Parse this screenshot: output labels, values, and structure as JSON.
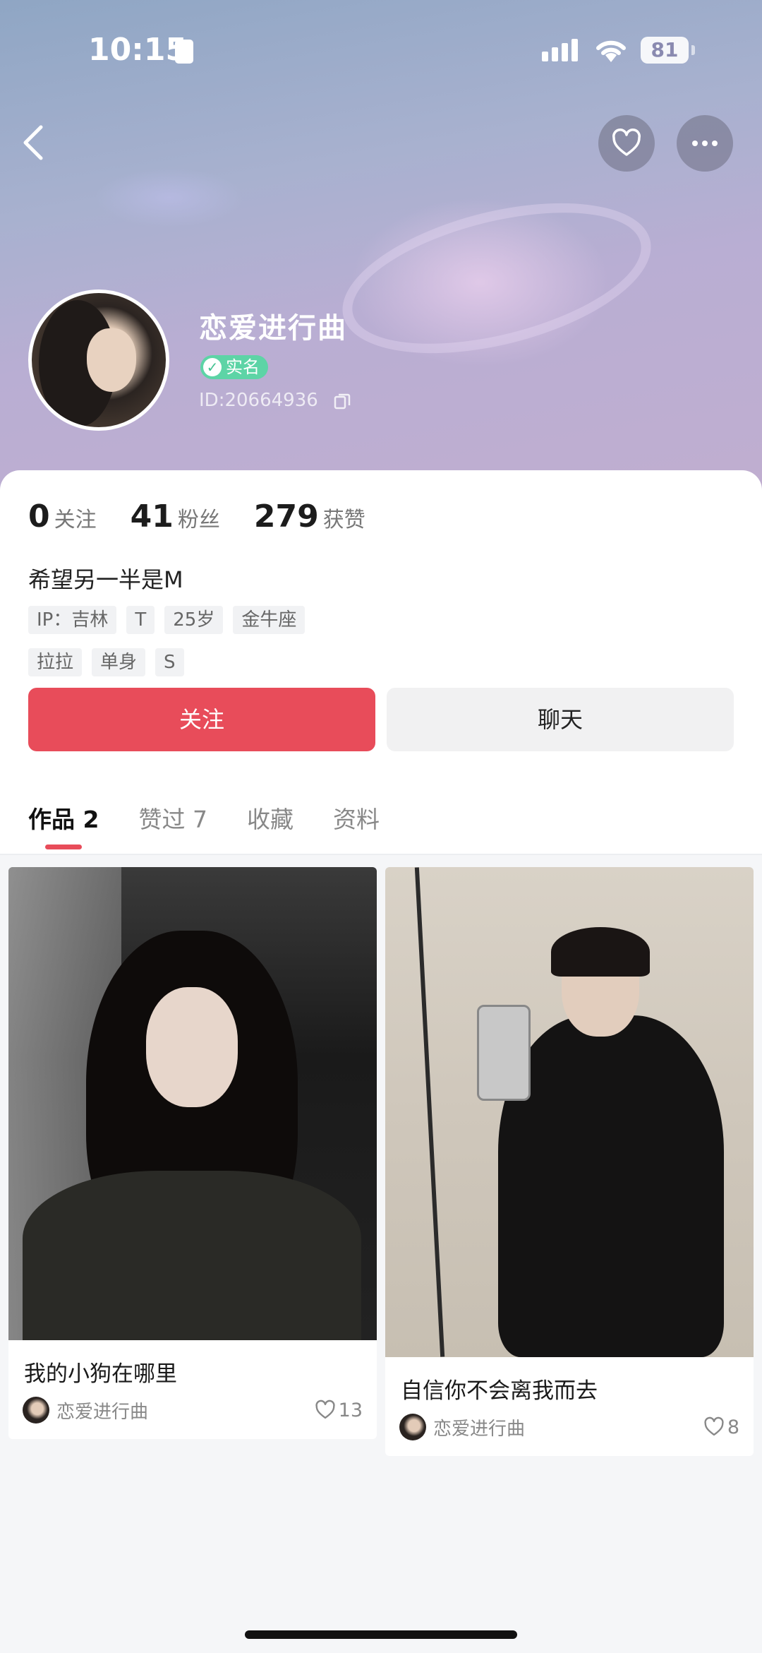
{
  "status_bar": {
    "time": "10:15",
    "battery": "81"
  },
  "profile": {
    "nickname": "恋爱进行曲",
    "verified_badge": "实名",
    "user_id": "ID:20664936"
  },
  "stats": [
    {
      "value": "0",
      "label": "关注"
    },
    {
      "value": "41",
      "label": "粉丝"
    },
    {
      "value": "279",
      "label": "获赞"
    }
  ],
  "bio": "希望另一半是M",
  "tags_row1": [
    "IP：吉林",
    "T",
    "25岁",
    "金牛座"
  ],
  "tags_row2": [
    "拉拉",
    "单身",
    "S"
  ],
  "actions": {
    "follow_label": "关注",
    "chat_label": "聊天"
  },
  "tabs": [
    {
      "label": "作品 2",
      "active": true
    },
    {
      "label": "赞过 7",
      "active": false
    },
    {
      "label": "收藏",
      "active": false
    },
    {
      "label": "资料",
      "active": false
    }
  ],
  "posts": [
    {
      "title": "我的小狗在哪里",
      "author": "恋爱进行曲",
      "likes": "13"
    },
    {
      "title": "自信你不会离我而去",
      "author": "恋爱进行曲",
      "likes": "8"
    }
  ],
  "icons": {
    "back": "chevron-left-icon",
    "like": "heart-icon",
    "more": "more-dots-icon",
    "copy": "copy-icon",
    "verified": "check-icon"
  },
  "colors": {
    "accent": "#e84c5a",
    "verified": "#5dd4a6"
  }
}
